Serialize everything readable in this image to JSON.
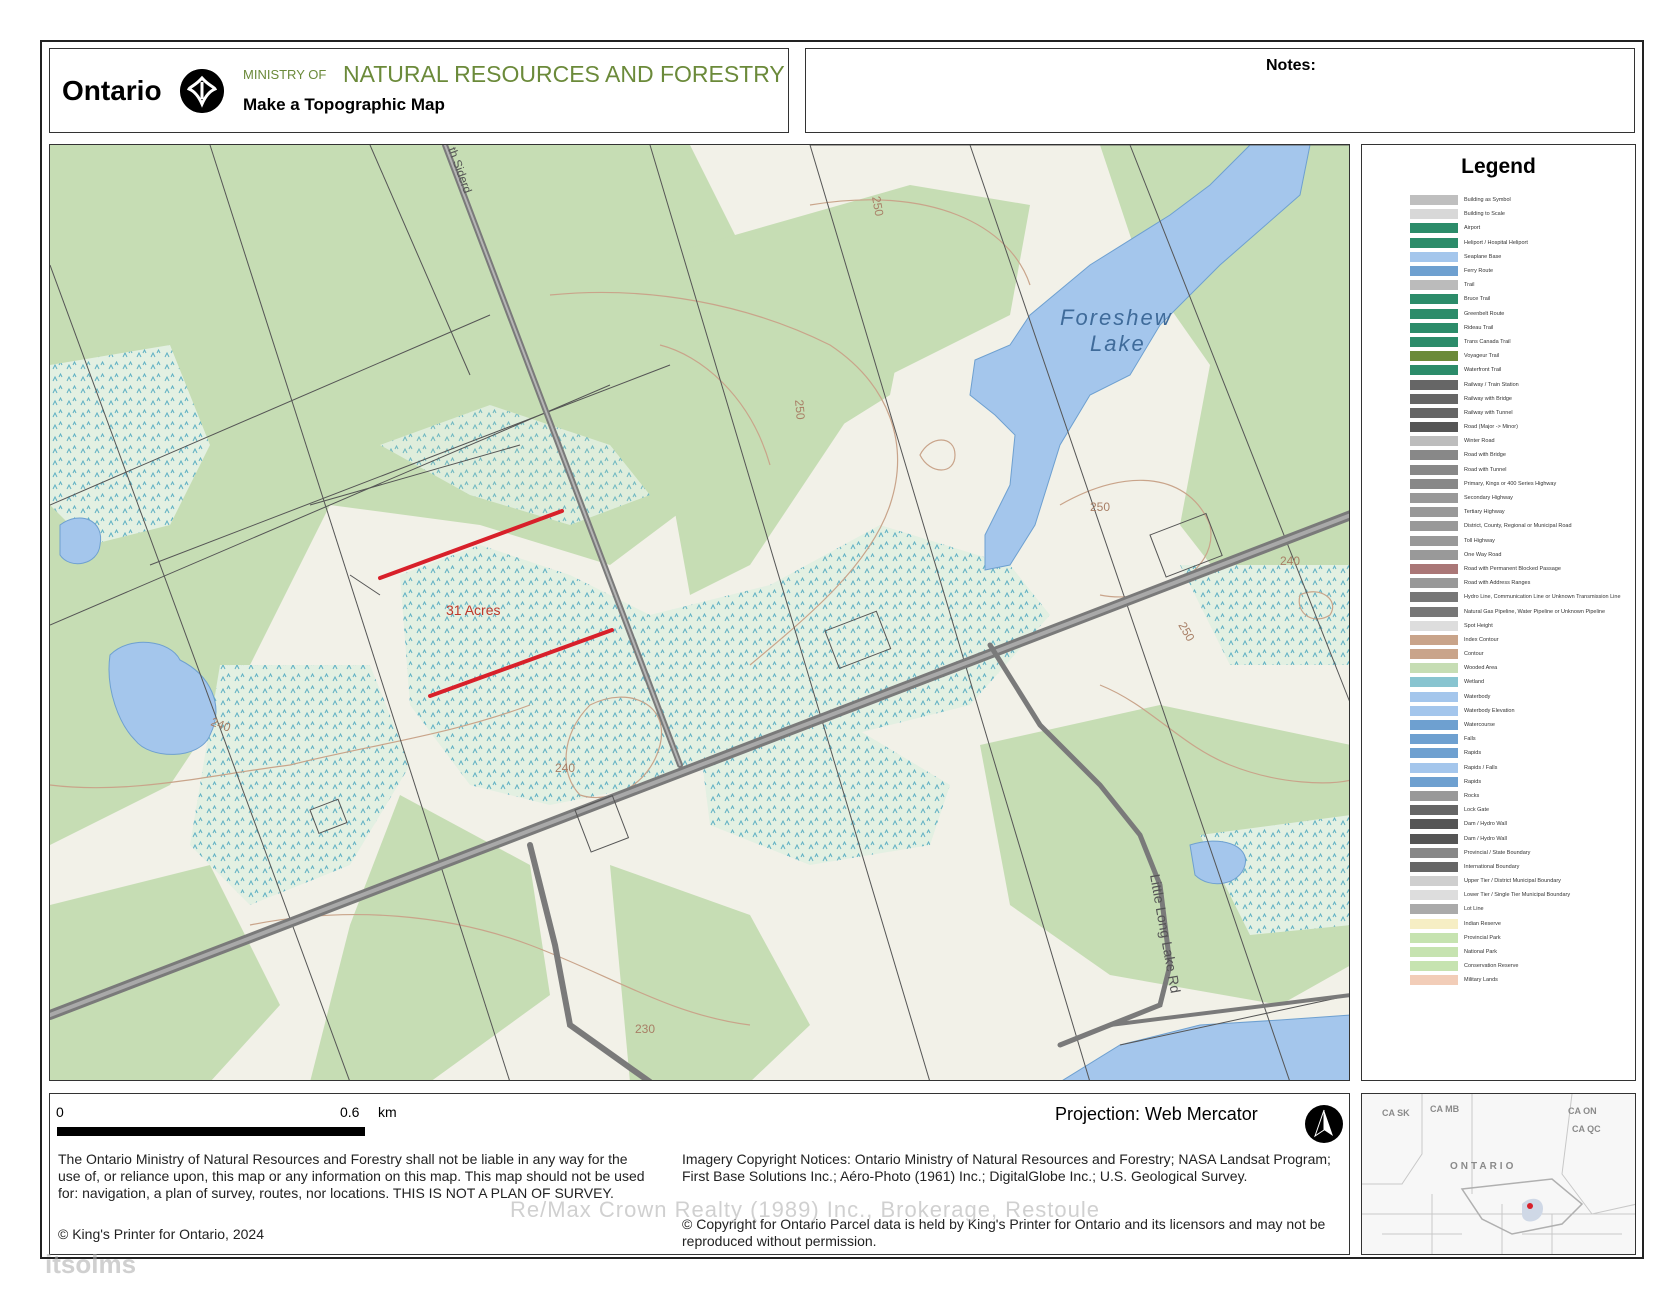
{
  "header": {
    "brand": "Ontario",
    "ministry_prefix": "MINISTRY OF",
    "ministry_name": "NATURAL RESOURCES AND FORESTRY",
    "subtitle": "Make a Topographic Map",
    "brand_color": "#6b8a3a"
  },
  "notes": {
    "label": "Notes:"
  },
  "map": {
    "labels": {
      "lake": [
        "Foreshew",
        "Lake"
      ],
      "parcel": "31 Acres",
      "road_top": "th Siderd",
      "road_right": "Little Long Lake Rd"
    },
    "contours": [
      "250",
      "250",
      "250",
      "250",
      "240",
      "240",
      "240",
      "230"
    ],
    "colors": {
      "woodland": "#c6ddb4",
      "water": "#a4c6ec",
      "wetland": "#88c4d0",
      "road": "#8d8d8d",
      "parcel_line": "#d8202a",
      "contour": "#c9a48a"
    }
  },
  "legend": {
    "title": "Legend",
    "items": [
      "Building as Symbol",
      "Building to Scale",
      "Airport",
      "Heliport / Hospital Heliport",
      "Seaplane Base",
      "Ferry Route",
      "Trail",
      "Bruce Trail",
      "Greenbelt Route",
      "Rideau Trail",
      "Trans Canada Trail",
      "Voyageur Trail",
      "Waterfront Trail",
      "Railway / Train Station",
      "Railway with Bridge",
      "Railway with Tunnel",
      "Road (Major -> Minor)",
      "Winter Road",
      "Road with Bridge",
      "Road with Tunnel",
      "Primary, Kings or 400 Series Highway",
      "Secondary Highway",
      "Tertiary Highway",
      "District, County, Regional or Municipal Road",
      "Toll Highway",
      "One Way Road",
      "Road with Permanent Blocked Passage",
      "Road with Address Ranges",
      "Hydro Line, Communication Line or Unknown Transmission Line",
      "Natural Gas Pipeline, Water Pipeline or Unknown Pipeline",
      "Spot Height",
      "Index Contour",
      "Contour",
      "Wooded Area",
      "Wetland",
      "Waterbody",
      "Waterbody Elevation",
      "Watercourse",
      "Falls",
      "Rapids",
      "Rapids / Falls",
      "Rapids",
      "Rocks",
      "Lock Gate",
      "Dam / Hydro Wall",
      "Dam / Hydro Wall",
      "Provincial / State Boundary",
      "International Boundary",
      "Upper Tier / District Municipal Boundary",
      "Lower Tier / Single Tier Municipal Boundary",
      "Lot Line",
      "Indian Reserve",
      "Provincial Park",
      "National Park",
      "Conservation Reserve",
      "Military Lands"
    ]
  },
  "footer": {
    "scale_start": "0",
    "scale_end": "0.6",
    "scale_unit": "km",
    "disclaimer": "The Ontario Ministry of Natural Resources and Forestry shall not be liable in any way for the use of, or reliance upon, this map or any information on this map.  This map should not be used for: navigation, a plan of survey, routes, nor locations. THIS IS NOT A PLAN OF SURVEY.",
    "copyright_left": "© King's Printer for Ontario,  2024",
    "projection": "Projection: Web Mercator",
    "imagery_notice": "Imagery Copyright Notices: Ontario Ministry of Natural Resources and Forestry; NASA Landsat Program; First Base Solutions Inc.; Aéro-Photo (1961) Inc.; DigitalGlobe Inc.; U.S. Geological Survey.",
    "parcel_notice": "© Copyright for Ontario Parcel data is held by King's Printer for Ontario and its licensors and may not be reproduced without permission."
  },
  "inset": {
    "labels": [
      "CA SK",
      "CA MB",
      "CA QC",
      "CA ON",
      "ONTARIO"
    ]
  },
  "overlay": {
    "watermark": "Re/Max Crown Realty (1989) Inc., Brokerage, Restoule",
    "mls_tag": "itsolms"
  }
}
